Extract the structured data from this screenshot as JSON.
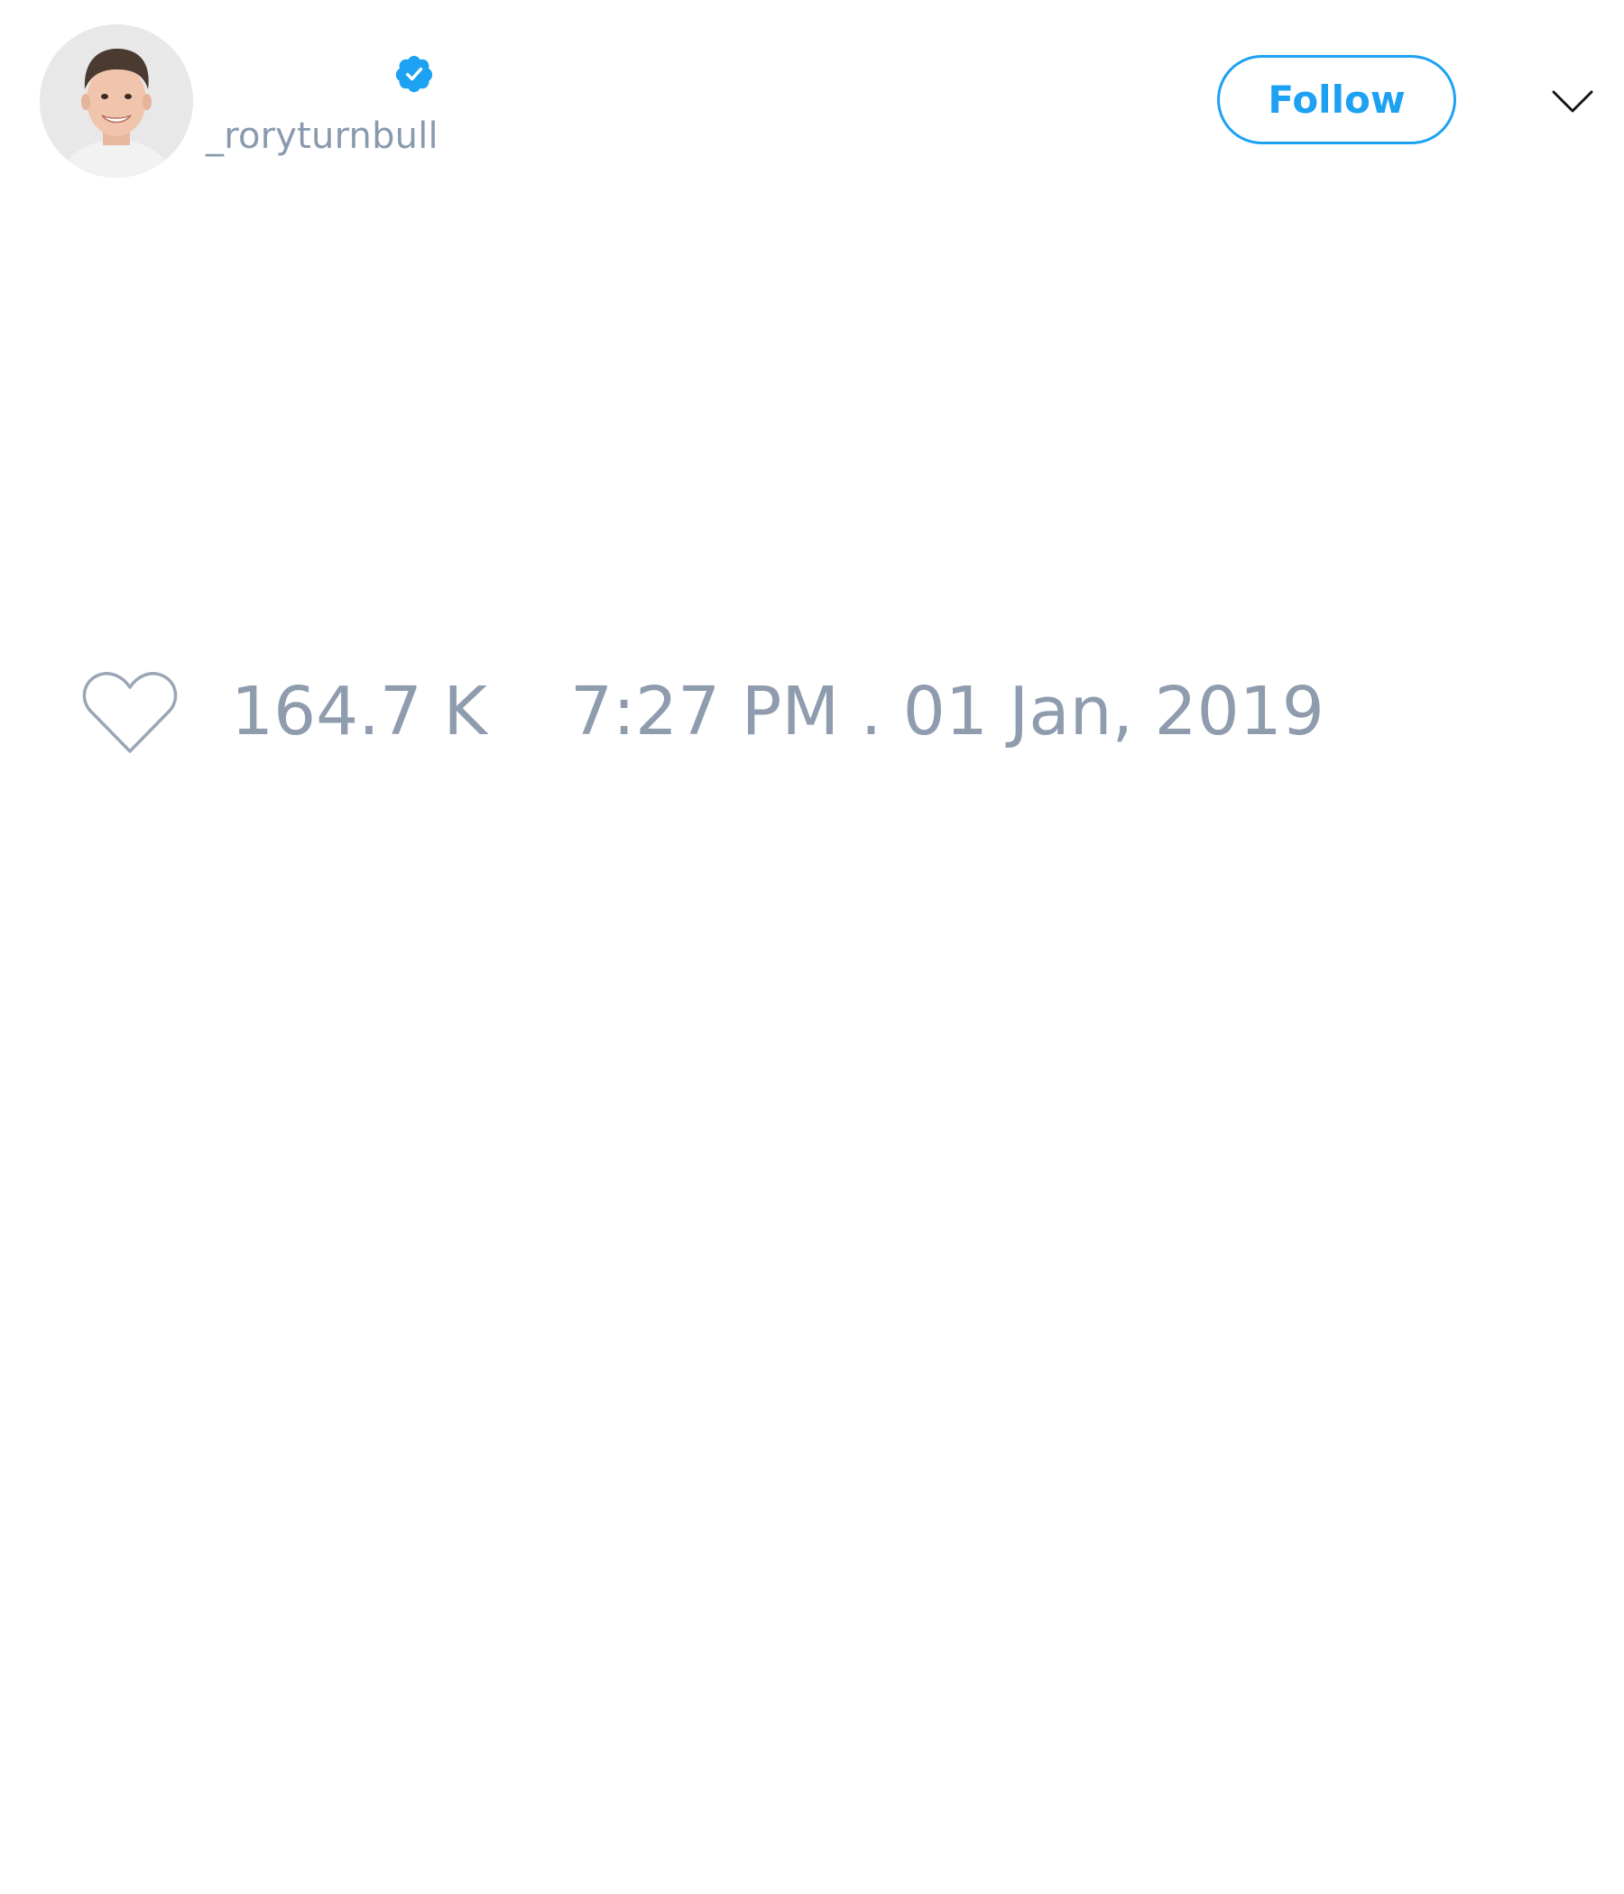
{
  "tweet": {
    "author": {
      "display_name": "",
      "handle": "_roryturnbull",
      "verified": true,
      "avatar": "profile-photo"
    },
    "follow_label": "Follow",
    "menu_icon": "chevron-down-icon",
    "like_icon": "heart-outline-icon",
    "like_count": "164.7 K",
    "timestamp": "7:27 PM . 01 Jan, 2019"
  },
  "colors": {
    "accent": "#1da1f2",
    "muted_text": "#8f9cae",
    "background": "#ffffff"
  }
}
